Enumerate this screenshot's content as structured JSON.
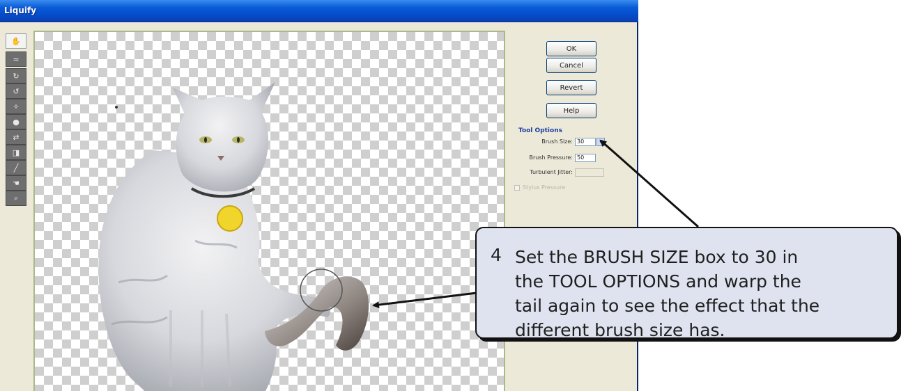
{
  "window": {
    "title": "Liquify"
  },
  "toolbar": {
    "tools": [
      {
        "icon": "warp-tool-icon",
        "glyph": "✋"
      },
      {
        "icon": "turbulence-tool-icon",
        "glyph": "≈"
      },
      {
        "icon": "twirl-clockwise-icon",
        "glyph": "↻"
      },
      {
        "icon": "twirl-counterclockwise-icon",
        "glyph": "↺"
      },
      {
        "icon": "pucker-tool-icon",
        "glyph": "✧"
      },
      {
        "icon": "bloat-tool-icon",
        "glyph": "●"
      },
      {
        "icon": "shift-pixels-icon",
        "glyph": "⇄"
      },
      {
        "icon": "reflection-tool-icon",
        "glyph": "◨"
      },
      {
        "icon": "reconstruct-tool-icon",
        "glyph": "╱"
      },
      {
        "icon": "hand-tool-icon",
        "glyph": "☚"
      },
      {
        "icon": "zoom-tool-icon",
        "glyph": "⌕"
      }
    ]
  },
  "buttons": {
    "ok": "OK",
    "cancel": "Cancel",
    "revert": "Revert",
    "help": "Help"
  },
  "tool_options": {
    "title": "Tool Options",
    "brush_size_label": "Brush Size:",
    "brush_size_value": "30",
    "brush_pressure_label": "Brush Pressure:",
    "brush_pressure_value": "50",
    "turbulent_jitter_label": "Turbulent Jitter:",
    "turbulent_jitter_value": "",
    "stylus_pressure_label": "Stylus Pressure"
  },
  "callout": {
    "number": "4",
    "lines": [
      "Set the BRUSH SIZE box to 30 in",
      "the TOOL OPTIONS and warp the",
      "tail again to see the effect that the",
      "different brush size has."
    ]
  },
  "colors": {
    "title_bar": "#0a5bd6",
    "callout_fill": "#dfe3f0",
    "canvas_border": "#a9b98a"
  }
}
